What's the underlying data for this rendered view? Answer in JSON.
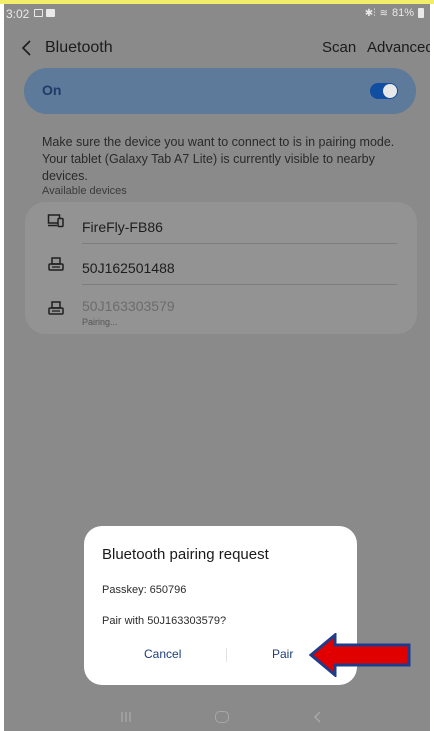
{
  "status_bar": {
    "time": "3:02",
    "battery": "81%"
  },
  "header": {
    "title": "Bluetooth",
    "scan": "Scan",
    "advanced": "Advanced"
  },
  "bluetooth_toggle": {
    "label": "On",
    "enabled": true
  },
  "info_text": "Make sure the device you want to connect to is in pairing mode. Your tablet (Galaxy Tab A7 Lite) is currently visible to nearby devices.",
  "available_devices": {
    "label": "Available devices",
    "items": [
      {
        "name": "FireFly-FB86",
        "icon": "devices-icon",
        "status": ""
      },
      {
        "name": "50J162501488",
        "icon": "printer-icon",
        "status": ""
      },
      {
        "name": "50J163303579",
        "icon": "printer-icon",
        "status": "Pairing..."
      }
    ]
  },
  "dialog": {
    "title": "Bluetooth pairing request",
    "passkey": "Passkey: 650796",
    "question": "Pair with 50J163303579?",
    "cancel": "Cancel",
    "pair": "Pair"
  },
  "colors": {
    "accent": "#1e3f7a",
    "annotation_arrow": "#e00000",
    "annotation_outline": "#1f3c8a"
  }
}
